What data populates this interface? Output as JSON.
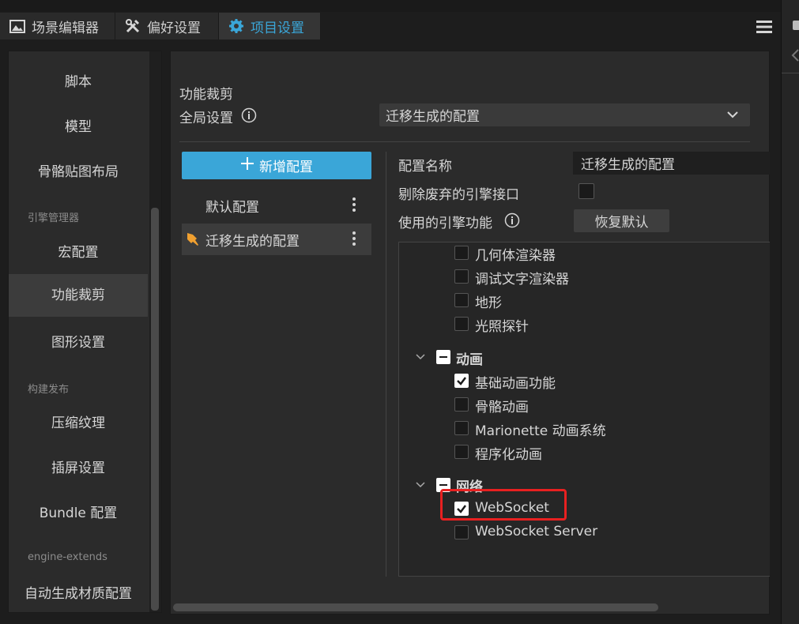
{
  "tabs": [
    {
      "label": "场景编辑器",
      "icon": "image-icon"
    },
    {
      "label": "偏好设置",
      "icon": "tools-icon"
    },
    {
      "label": "项目设置",
      "icon": "gear-icon",
      "active": true
    }
  ],
  "sidebar": {
    "items": [
      {
        "label": "脚本"
      },
      {
        "label": "模型"
      },
      {
        "label": "骨骼贴图布局"
      },
      {
        "group": "引擎管理器"
      },
      {
        "label": "宏配置"
      },
      {
        "label": "功能裁剪",
        "active": true
      },
      {
        "label": "图形设置"
      },
      {
        "group": "构建发布"
      },
      {
        "label": "压缩纹理"
      },
      {
        "label": "插屏设置"
      },
      {
        "label": "Bundle 配置"
      },
      {
        "group": "engine-extends"
      },
      {
        "label": "自动生成材质配置"
      }
    ]
  },
  "main": {
    "section_title": "功能裁剪",
    "global_label": "全局设置",
    "global_value": "迁移生成的配置",
    "add_button": "新增配置",
    "configs": [
      {
        "label": "默认配置"
      },
      {
        "label": "迁移生成的配置",
        "active": true
      }
    ],
    "config_name_label": "配置名称",
    "config_name_value": "迁移生成的配置",
    "remove_deprecated_label": "剔除废弃的引擎接口",
    "engine_features_label": "使用的引擎功能",
    "reset_button": "恢复默认",
    "tree": [
      {
        "label": "几何体渲染器",
        "checked": false
      },
      {
        "label": "调试文字渲染器",
        "checked": false
      },
      {
        "label": "地形",
        "checked": false
      },
      {
        "label": "光照探针",
        "checked": false
      },
      {
        "group": "动画"
      },
      {
        "label": "基础动画功能",
        "checked": true
      },
      {
        "label": "骨骼动画",
        "checked": false
      },
      {
        "label": "Marionette 动画系统",
        "checked": false
      },
      {
        "label": "程序化动画",
        "checked": false
      },
      {
        "group": "网络"
      },
      {
        "label": "WebSocket",
        "checked": true
      },
      {
        "label": "WebSocket Server",
        "checked": false
      }
    ]
  },
  "colors": {
    "accent": "#3aa6d8",
    "highlight": "#e82020",
    "favorite": "#f0a030"
  }
}
